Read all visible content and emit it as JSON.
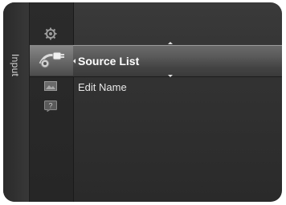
{
  "sidebar": {
    "label": "Input"
  },
  "menu": {
    "items": [
      {
        "label": "Source List"
      },
      {
        "label": "Edit Name"
      }
    ]
  },
  "icons": [
    "settings-icon",
    "input-plug-icon",
    "picture-icon",
    "help-icon"
  ]
}
